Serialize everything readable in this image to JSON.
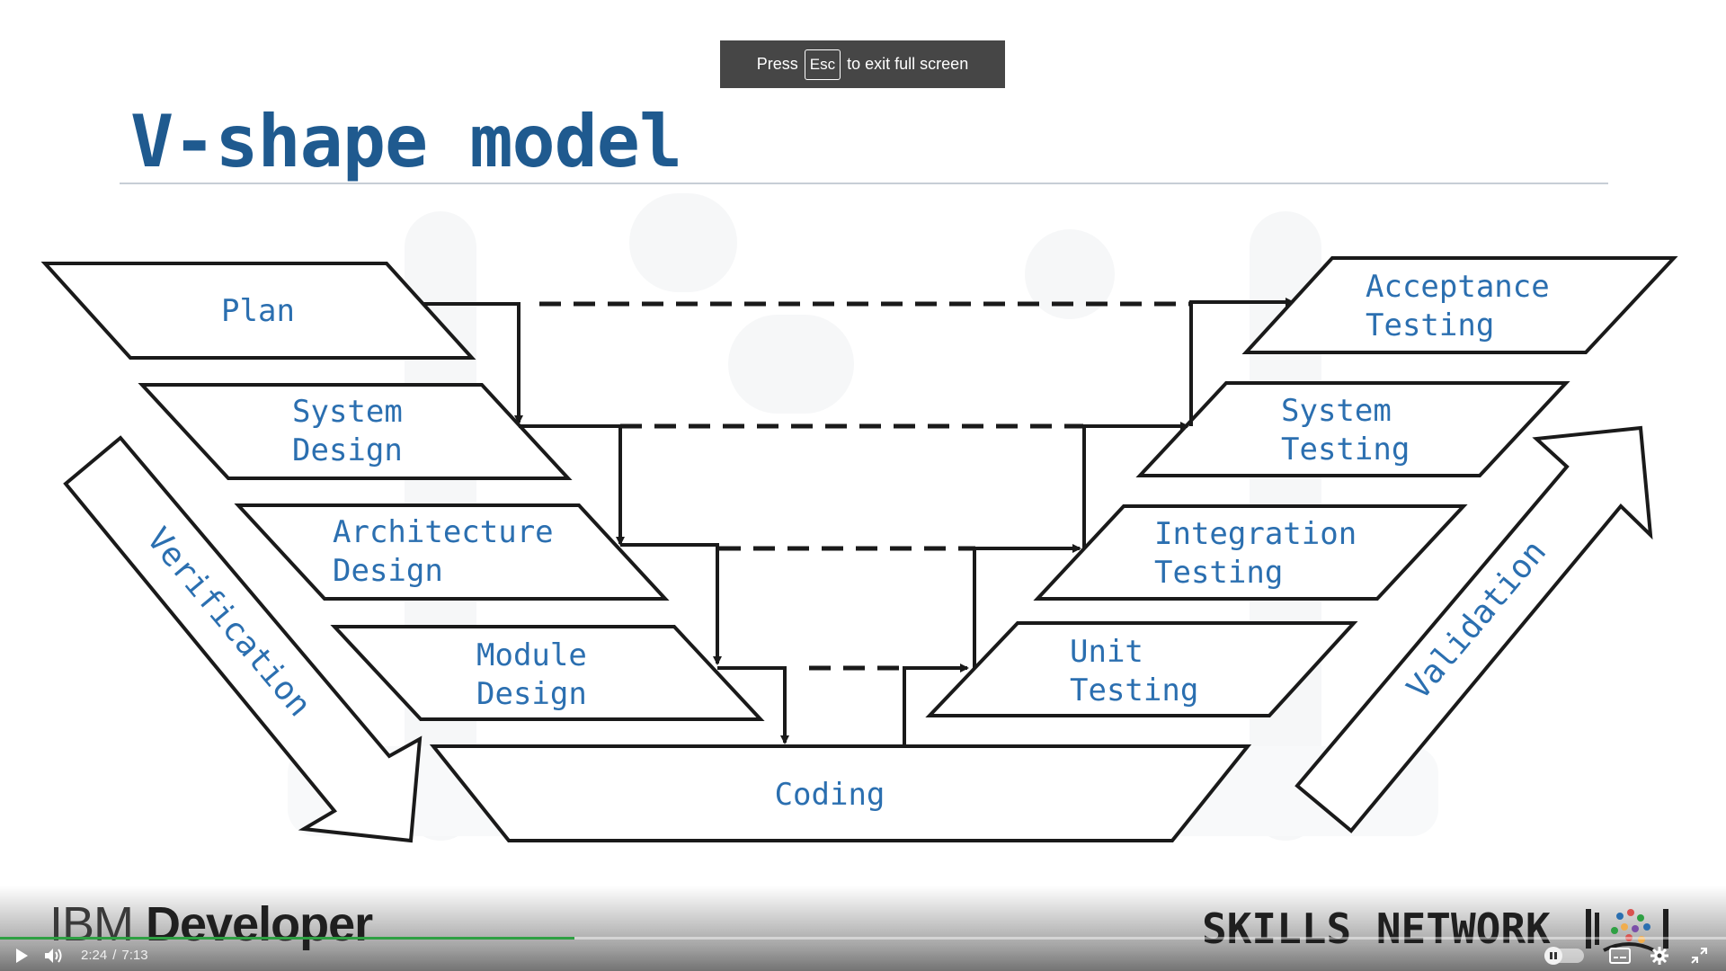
{
  "toast": {
    "press": "Press",
    "key": "Esc",
    "rest": "to exit full screen"
  },
  "slide": {
    "title": "V-shape model",
    "left_phases": [
      {
        "line1": "Plan",
        "line2": ""
      },
      {
        "line1": "System",
        "line2": "Design"
      },
      {
        "line1": "Architecture",
        "line2": "Design"
      },
      {
        "line1": "Module",
        "line2": "Design"
      }
    ],
    "bottom_phase": "Coding",
    "right_phases": [
      {
        "line1": "Acceptance",
        "line2": "Testing"
      },
      {
        "line1": "System",
        "line2": "Testing"
      },
      {
        "line1": "Integration",
        "line2": "Testing"
      },
      {
        "line1": "Unit",
        "line2": "Testing"
      }
    ],
    "left_arrow_label": "Verification",
    "right_arrow_label": "Validation",
    "stroke_color": "#1a1a1a",
    "text_color": "#2b6fb0",
    "title_color": "#1f5a8f"
  },
  "branding": {
    "ibm_word1": "IBM",
    "ibm_word2": "Developer",
    "skills": "SKILLS NETWORK"
  },
  "player": {
    "current_time": "2:24",
    "separator": "/",
    "duration": "7:13",
    "progress_fraction": 0.333,
    "progress_color": "#2ea043",
    "icons": {
      "play": "play-icon",
      "volume": "volume-icon",
      "autoplay": "autoplay-pause-icon",
      "captions": "captions-icon",
      "settings": "gear-icon",
      "exit_fullscreen": "exit-fullscreen-icon"
    }
  }
}
